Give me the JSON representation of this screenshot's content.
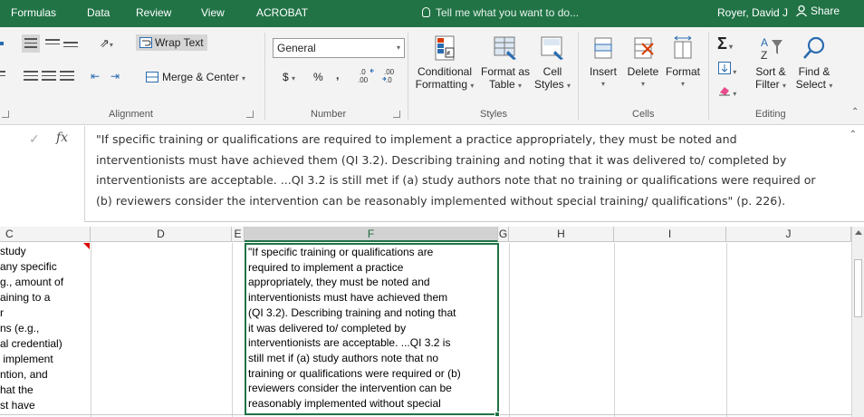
{
  "tabs": [
    "Formulas",
    "Data",
    "Review",
    "View",
    "ACROBAT"
  ],
  "tell_me": "Tell me what you want to do...",
  "user": "Royer, David J",
  "share": "Share",
  "ribbon": {
    "wrap_text": "Wrap Text",
    "merge_center": "Merge & Center",
    "number_format": "General",
    "currency": "$",
    "percent": "%",
    "comma": ",",
    "inc_decimal": "←.0\n.00",
    "conditional_formatting": [
      "Conditional",
      "Formatting"
    ],
    "format_as_table": [
      "Format as",
      "Table"
    ],
    "cell_styles": [
      "Cell",
      "Styles"
    ],
    "insert": "Insert",
    "delete": "Delete",
    "format": "Format",
    "sort_filter": [
      "Sort &",
      "Filter"
    ],
    "find_select": [
      "Find &",
      "Select"
    ],
    "groups": {
      "alignment": "Alignment",
      "number": "Number",
      "styles": "Styles",
      "cells": "Cells",
      "editing": "Editing"
    }
  },
  "formula_bar": {
    "fx": "fx",
    "lines": [
      "\"If specific training or qualifications are required to implement a practice appropriately, they must be noted and",
      "interventionists must have achieved them (QI 3.2). Describing training and noting that it was delivered to/ completed by",
      "interventionists are acceptable. ...QI 3.2 is still met if (a) study authors note that no training or qualifications were required or",
      "(b) reviewers consider the intervention can be reasonably implemented without special training/ qualifications\" (p. 226)."
    ]
  },
  "columns": [
    "C",
    "D",
    "E",
    "F",
    "G",
    "H",
    "I",
    "J"
  ],
  "cell_c_lines": [
    "study",
    "any specific",
    "g., amount of",
    "aining to a",
    "r",
    "ns (e.g.,",
    "al credential)",
    " implement",
    "ntion, and",
    "hat the",
    "st have"
  ],
  "cell_f_lines": [
    "\"If specific training or qualifications are",
    "required to implement a practice",
    "appropriately, they must be noted and",
    "interventionists must have achieved them",
    "(QI 3.2). Describing training and noting that",
    "it was delivered to/ completed by",
    "interventionists are acceptable. ...QI 3.2 is",
    "still met if (a) study authors note that no",
    "training or qualifications were required or (b)",
    "reviewers consider the intervention can be",
    "reasonably implemented without special"
  ],
  "colors": {
    "accent": "#217346",
    "comment": "#dd0000"
  }
}
